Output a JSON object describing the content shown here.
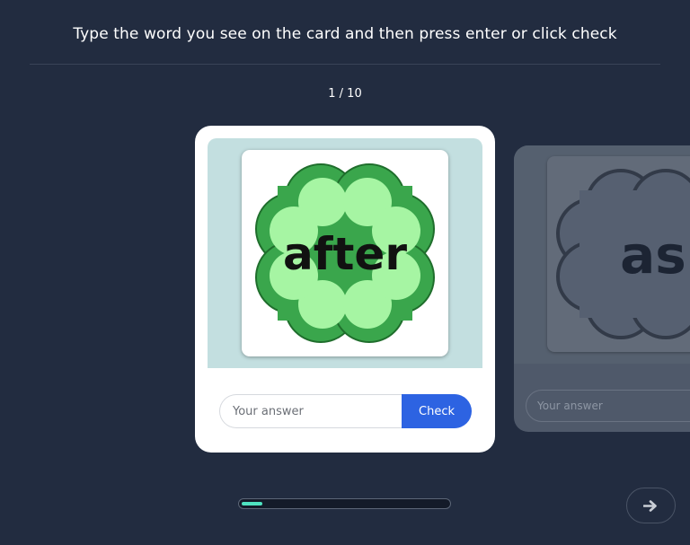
{
  "instruction": "Type the word you see on the card and then press enter or click check",
  "counter": "1 / 10",
  "progress": {
    "current": 1,
    "total": 10,
    "fraction": 0.1
  },
  "current_card": {
    "word": "after",
    "answer_placeholder": "Your answer",
    "answer_value": "",
    "check_label": "Check"
  },
  "next_card": {
    "word": "as",
    "answer_placeholder": "Your answer"
  },
  "icons": {
    "card_shape": "four-leaf-clover",
    "next": "arrow-right-icon"
  },
  "colors": {
    "background": "#222c40",
    "clover_dark": "#3aa64c",
    "clover_light": "#a6f5a3",
    "check_button": "#2d63e2",
    "progress_fill": "#4fe3c1",
    "card_backdrop": "#c3dfe0"
  }
}
